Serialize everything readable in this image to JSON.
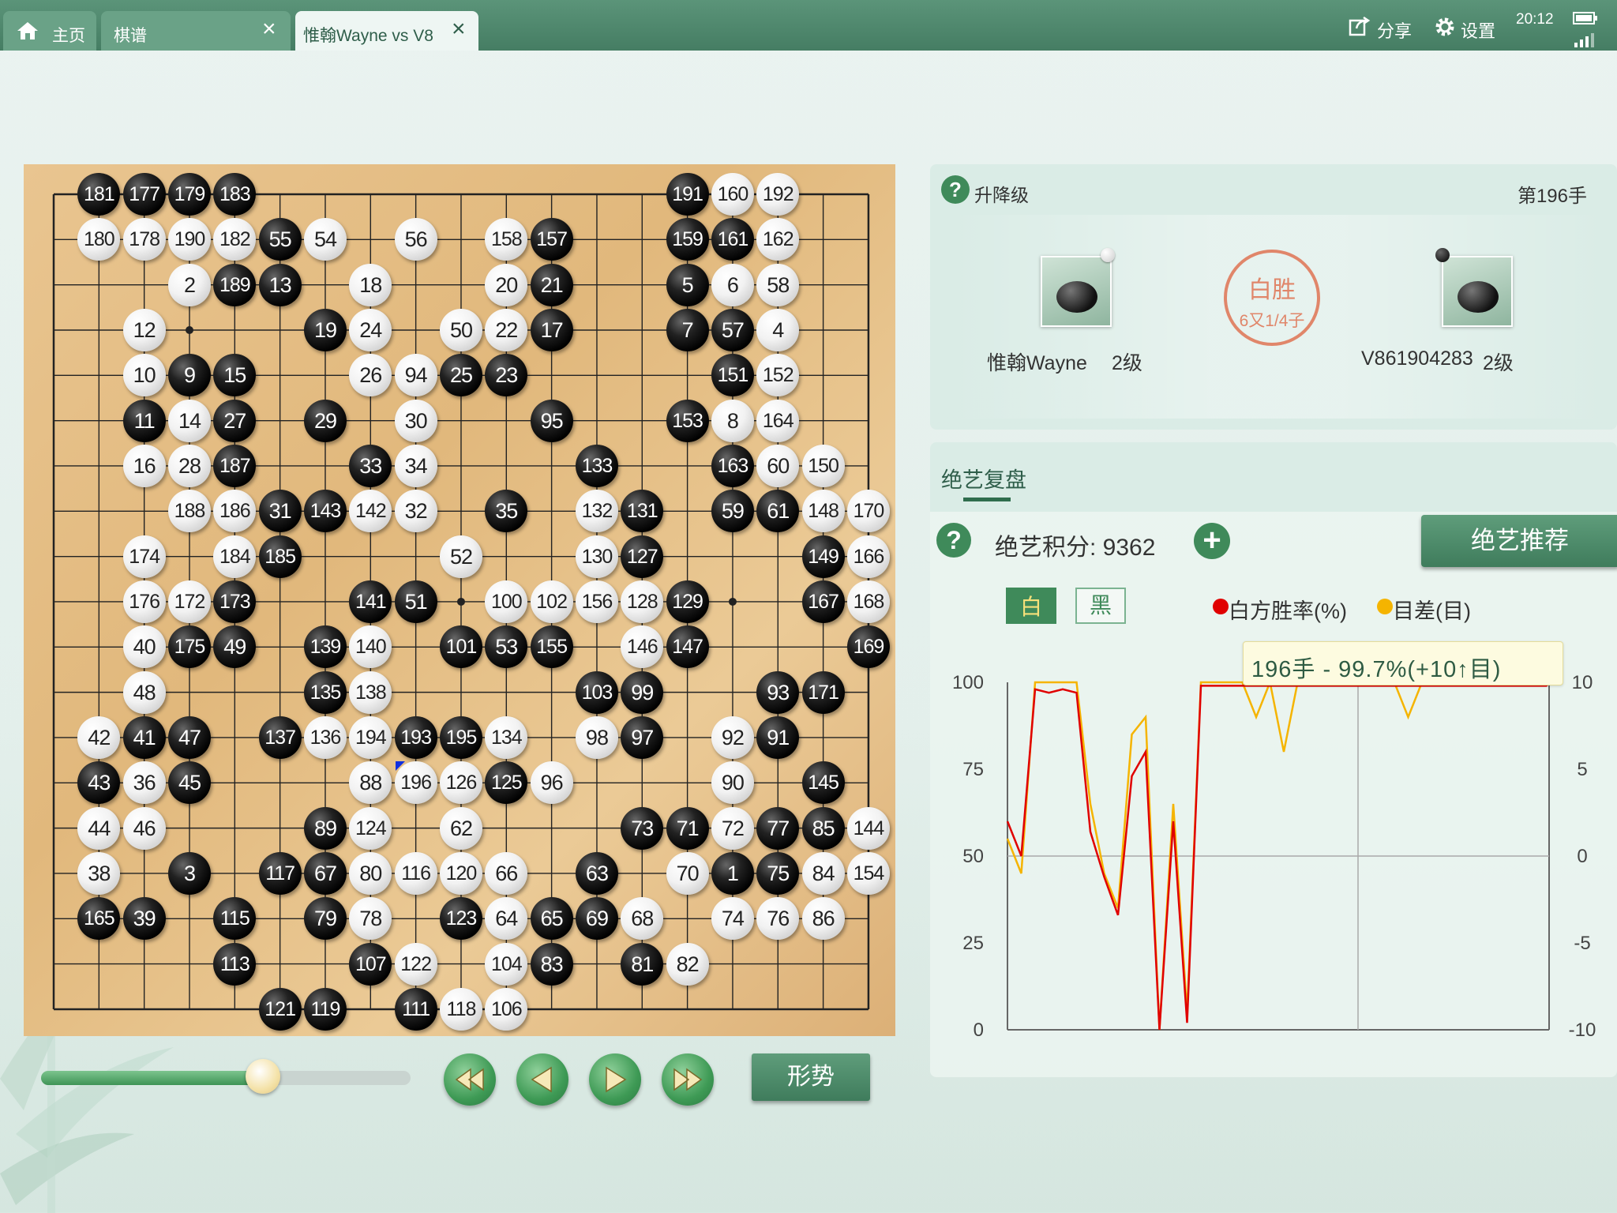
{
  "tabs": [
    {
      "label": "主页",
      "icon": "home-icon"
    },
    {
      "label": "棋谱",
      "close": "×"
    },
    {
      "label": "惟翰Wayne vs V8",
      "close": "×"
    }
  ],
  "toolbar": {
    "share": "分享",
    "settings": "设置",
    "time": "20:12",
    "icons": [
      "share-icon",
      "gear-icon",
      "battery-icon",
      "signal-icon"
    ]
  },
  "board": {
    "size": 19,
    "last_move": 196,
    "stones": [
      {
        "n": "181",
        "c": "b",
        "x": 1,
        "y": 0
      },
      {
        "n": "177",
        "c": "b",
        "x": 2,
        "y": 0
      },
      {
        "n": "179",
        "c": "b",
        "x": 3,
        "y": 0
      },
      {
        "n": "183",
        "c": "b",
        "x": 4,
        "y": 0
      },
      {
        "n": "191",
        "c": "b",
        "x": 14,
        "y": 0
      },
      {
        "n": "160",
        "c": "w",
        "x": 15,
        "y": 0
      },
      {
        "n": "192",
        "c": "w",
        "x": 16,
        "y": 0
      },
      {
        "n": "180",
        "c": "w",
        "x": 1,
        "y": 1
      },
      {
        "n": "178",
        "c": "w",
        "x": 2,
        "y": 1
      },
      {
        "n": "190",
        "c": "w",
        "x": 3,
        "y": 1
      },
      {
        "n": "182",
        "c": "w",
        "x": 4,
        "y": 1
      },
      {
        "n": "55",
        "c": "b",
        "x": 5,
        "y": 1
      },
      {
        "n": "54",
        "c": "w",
        "x": 6,
        "y": 1
      },
      {
        "n": "56",
        "c": "w",
        "x": 8,
        "y": 1
      },
      {
        "n": "158",
        "c": "w",
        "x": 10,
        "y": 1
      },
      {
        "n": "157",
        "c": "b",
        "x": 11,
        "y": 1
      },
      {
        "n": "159",
        "c": "b",
        "x": 14,
        "y": 1
      },
      {
        "n": "161",
        "c": "b",
        "x": 15,
        "y": 1
      },
      {
        "n": "162",
        "c": "w",
        "x": 16,
        "y": 1
      },
      {
        "n": "2",
        "c": "w",
        "x": 3,
        "y": 2
      },
      {
        "n": "189",
        "c": "b",
        "x": 4,
        "y": 2
      },
      {
        "n": "13",
        "c": "b",
        "x": 5,
        "y": 2
      },
      {
        "n": "18",
        "c": "w",
        "x": 7,
        "y": 2
      },
      {
        "n": "20",
        "c": "w",
        "x": 10,
        "y": 2
      },
      {
        "n": "21",
        "c": "b",
        "x": 11,
        "y": 2
      },
      {
        "n": "5",
        "c": "b",
        "x": 14,
        "y": 2
      },
      {
        "n": "6",
        "c": "w",
        "x": 15,
        "y": 2
      },
      {
        "n": "58",
        "c": "w",
        "x": 16,
        "y": 2
      },
      {
        "n": "12",
        "c": "w",
        "x": 2,
        "y": 3
      },
      {
        "n": "19",
        "c": "b",
        "x": 6,
        "y": 3
      },
      {
        "n": "24",
        "c": "w",
        "x": 7,
        "y": 3
      },
      {
        "n": "50",
        "c": "w",
        "x": 9,
        "y": 3
      },
      {
        "n": "22",
        "c": "w",
        "x": 10,
        "y": 3
      },
      {
        "n": "17",
        "c": "b",
        "x": 11,
        "y": 3
      },
      {
        "n": "7",
        "c": "b",
        "x": 14,
        "y": 3
      },
      {
        "n": "57",
        "c": "b",
        "x": 15,
        "y": 3
      },
      {
        "n": "4",
        "c": "w",
        "x": 16,
        "y": 3
      },
      {
        "n": "10",
        "c": "w",
        "x": 2,
        "y": 4
      },
      {
        "n": "9",
        "c": "b",
        "x": 3,
        "y": 4
      },
      {
        "n": "15",
        "c": "b",
        "x": 4,
        "y": 4
      },
      {
        "n": "26",
        "c": "w",
        "x": 7,
        "y": 4
      },
      {
        "n": "94",
        "c": "w",
        "x": 8,
        "y": 4
      },
      {
        "n": "25",
        "c": "b",
        "x": 9,
        "y": 4
      },
      {
        "n": "23",
        "c": "b",
        "x": 10,
        "y": 4
      },
      {
        "n": "151",
        "c": "b",
        "x": 15,
        "y": 4
      },
      {
        "n": "152",
        "c": "w",
        "x": 16,
        "y": 4
      },
      {
        "n": "11",
        "c": "b",
        "x": 2,
        "y": 5
      },
      {
        "n": "14",
        "c": "w",
        "x": 3,
        "y": 5
      },
      {
        "n": "27",
        "c": "b",
        "x": 4,
        "y": 5
      },
      {
        "n": "29",
        "c": "b",
        "x": 6,
        "y": 5
      },
      {
        "n": "30",
        "c": "w",
        "x": 8,
        "y": 5
      },
      {
        "n": "95",
        "c": "b",
        "x": 11,
        "y": 5
      },
      {
        "n": "153",
        "c": "b",
        "x": 14,
        "y": 5
      },
      {
        "n": "8",
        "c": "w",
        "x": 15,
        "y": 5
      },
      {
        "n": "164",
        "c": "w",
        "x": 16,
        "y": 5
      },
      {
        "n": "16",
        "c": "w",
        "x": 2,
        "y": 6
      },
      {
        "n": "28",
        "c": "w",
        "x": 3,
        "y": 6
      },
      {
        "n": "187",
        "c": "b",
        "x": 4,
        "y": 6
      },
      {
        "n": "33",
        "c": "b",
        "x": 7,
        "y": 6
      },
      {
        "n": "34",
        "c": "w",
        "x": 8,
        "y": 6
      },
      {
        "n": "133",
        "c": "b",
        "x": 12,
        "y": 6
      },
      {
        "n": "163",
        "c": "b",
        "x": 15,
        "y": 6
      },
      {
        "n": "60",
        "c": "w",
        "x": 16,
        "y": 6
      },
      {
        "n": "150",
        "c": "w",
        "x": 17,
        "y": 6
      },
      {
        "n": "188",
        "c": "w",
        "x": 3,
        "y": 7
      },
      {
        "n": "186",
        "c": "w",
        "x": 4,
        "y": 7
      },
      {
        "n": "31",
        "c": "b",
        "x": 5,
        "y": 7
      },
      {
        "n": "143",
        "c": "b",
        "x": 6,
        "y": 7
      },
      {
        "n": "142",
        "c": "w",
        "x": 7,
        "y": 7
      },
      {
        "n": "32",
        "c": "w",
        "x": 8,
        "y": 7
      },
      {
        "n": "35",
        "c": "b",
        "x": 10,
        "y": 7
      },
      {
        "n": "132",
        "c": "w",
        "x": 12,
        "y": 7
      },
      {
        "n": "131",
        "c": "b",
        "x": 13,
        "y": 7
      },
      {
        "n": "59",
        "c": "b",
        "x": 15,
        "y": 7
      },
      {
        "n": "61",
        "c": "b",
        "x": 16,
        "y": 7
      },
      {
        "n": "148",
        "c": "w",
        "x": 17,
        "y": 7
      },
      {
        "n": "170",
        "c": "w",
        "x": 18,
        "y": 7
      },
      {
        "n": "174",
        "c": "w",
        "x": 2,
        "y": 8
      },
      {
        "n": "184",
        "c": "w",
        "x": 4,
        "y": 8
      },
      {
        "n": "185",
        "c": "b",
        "x": 5,
        "y": 8
      },
      {
        "n": "52",
        "c": "w",
        "x": 9,
        "y": 8
      },
      {
        "n": "130",
        "c": "w",
        "x": 12,
        "y": 8
      },
      {
        "n": "127",
        "c": "b",
        "x": 13,
        "y": 8
      },
      {
        "n": "149",
        "c": "b",
        "x": 17,
        "y": 8
      },
      {
        "n": "166",
        "c": "w",
        "x": 18,
        "y": 8
      },
      {
        "n": "176",
        "c": "w",
        "x": 2,
        "y": 9
      },
      {
        "n": "172",
        "c": "w",
        "x": 3,
        "y": 9
      },
      {
        "n": "173",
        "c": "b",
        "x": 4,
        "y": 9
      },
      {
        "n": "141",
        "c": "b",
        "x": 7,
        "y": 9
      },
      {
        "n": "51",
        "c": "b",
        "x": 8,
        "y": 9
      },
      {
        "n": "100",
        "c": "w",
        "x": 10,
        "y": 9
      },
      {
        "n": "102",
        "c": "w",
        "x": 11,
        "y": 9
      },
      {
        "n": "156",
        "c": "w",
        "x": 12,
        "y": 9
      },
      {
        "n": "128",
        "c": "w",
        "x": 13,
        "y": 9
      },
      {
        "n": "129",
        "c": "b",
        "x": 14,
        "y": 9
      },
      {
        "n": "167",
        "c": "b",
        "x": 17,
        "y": 9
      },
      {
        "n": "168",
        "c": "w",
        "x": 18,
        "y": 9
      },
      {
        "n": "40",
        "c": "w",
        "x": 2,
        "y": 10
      },
      {
        "n": "175",
        "c": "b",
        "x": 3,
        "y": 10
      },
      {
        "n": "49",
        "c": "b",
        "x": 4,
        "y": 10
      },
      {
        "n": "139",
        "c": "b",
        "x": 6,
        "y": 10
      },
      {
        "n": "140",
        "c": "w",
        "x": 7,
        "y": 10
      },
      {
        "n": "101",
        "c": "b",
        "x": 9,
        "y": 10
      },
      {
        "n": "53",
        "c": "b",
        "x": 10,
        "y": 10
      },
      {
        "n": "155",
        "c": "b",
        "x": 11,
        "y": 10
      },
      {
        "n": "146",
        "c": "w",
        "x": 13,
        "y": 10
      },
      {
        "n": "147",
        "c": "b",
        "x": 14,
        "y": 10
      },
      {
        "n": "169",
        "c": "b",
        "x": 18,
        "y": 10
      },
      {
        "n": "48",
        "c": "w",
        "x": 2,
        "y": 11
      },
      {
        "n": "135",
        "c": "b",
        "x": 6,
        "y": 11
      },
      {
        "n": "138",
        "c": "w",
        "x": 7,
        "y": 11
      },
      {
        "n": "103",
        "c": "b",
        "x": 12,
        "y": 11
      },
      {
        "n": "99",
        "c": "b",
        "x": 13,
        "y": 11
      },
      {
        "n": "93",
        "c": "b",
        "x": 16,
        "y": 11
      },
      {
        "n": "171",
        "c": "b",
        "x": 17,
        "y": 11
      },
      {
        "n": "42",
        "c": "w",
        "x": 1,
        "y": 12
      },
      {
        "n": "41",
        "c": "b",
        "x": 2,
        "y": 12
      },
      {
        "n": "47",
        "c": "b",
        "x": 3,
        "y": 12
      },
      {
        "n": "137",
        "c": "b",
        "x": 5,
        "y": 12
      },
      {
        "n": "136",
        "c": "w",
        "x": 6,
        "y": 12
      },
      {
        "n": "194",
        "c": "w",
        "x": 7,
        "y": 12
      },
      {
        "n": "193",
        "c": "b",
        "x": 8,
        "y": 12
      },
      {
        "n": "195",
        "c": "b",
        "x": 9,
        "y": 12
      },
      {
        "n": "134",
        "c": "w",
        "x": 10,
        "y": 12
      },
      {
        "n": "98",
        "c": "w",
        "x": 12,
        "y": 12
      },
      {
        "n": "97",
        "c": "b",
        "x": 13,
        "y": 12
      },
      {
        "n": "92",
        "c": "w",
        "x": 15,
        "y": 12
      },
      {
        "n": "91",
        "c": "b",
        "x": 16,
        "y": 12
      },
      {
        "n": "43",
        "c": "b",
        "x": 1,
        "y": 13
      },
      {
        "n": "36",
        "c": "w",
        "x": 2,
        "y": 13
      },
      {
        "n": "45",
        "c": "b",
        "x": 3,
        "y": 13
      },
      {
        "n": "88",
        "c": "w",
        "x": 7,
        "y": 13
      },
      {
        "n": "196",
        "c": "w",
        "x": 8,
        "y": 13
      },
      {
        "n": "126",
        "c": "w",
        "x": 9,
        "y": 13
      },
      {
        "n": "125",
        "c": "b",
        "x": 10,
        "y": 13
      },
      {
        "n": "96",
        "c": "w",
        "x": 11,
        "y": 13
      },
      {
        "n": "90",
        "c": "w",
        "x": 15,
        "y": 13
      },
      {
        "n": "145",
        "c": "b",
        "x": 17,
        "y": 13
      },
      {
        "n": "44",
        "c": "w",
        "x": 1,
        "y": 14
      },
      {
        "n": "46",
        "c": "w",
        "x": 2,
        "y": 14
      },
      {
        "n": "89",
        "c": "b",
        "x": 6,
        "y": 14
      },
      {
        "n": "124",
        "c": "w",
        "x": 7,
        "y": 14
      },
      {
        "n": "62",
        "c": "w",
        "x": 9,
        "y": 14
      },
      {
        "n": "73",
        "c": "b",
        "x": 13,
        "y": 14
      },
      {
        "n": "71",
        "c": "b",
        "x": 14,
        "y": 14
      },
      {
        "n": "72",
        "c": "w",
        "x": 15,
        "y": 14
      },
      {
        "n": "77",
        "c": "b",
        "x": 16,
        "y": 14
      },
      {
        "n": "85",
        "c": "b",
        "x": 17,
        "y": 14
      },
      {
        "n": "144",
        "c": "w",
        "x": 18,
        "y": 14
      },
      {
        "n": "38",
        "c": "w",
        "x": 1,
        "y": 15
      },
      {
        "n": "3",
        "c": "b",
        "x": 3,
        "y": 15
      },
      {
        "n": "117",
        "c": "b",
        "x": 5,
        "y": 15
      },
      {
        "n": "67",
        "c": "b",
        "x": 6,
        "y": 15
      },
      {
        "n": "80",
        "c": "w",
        "x": 7,
        "y": 15
      },
      {
        "n": "116",
        "c": "w",
        "x": 8,
        "y": 15
      },
      {
        "n": "120",
        "c": "w",
        "x": 9,
        "y": 15
      },
      {
        "n": "66",
        "c": "w",
        "x": 10,
        "y": 15
      },
      {
        "n": "63",
        "c": "b",
        "x": 12,
        "y": 15
      },
      {
        "n": "70",
        "c": "w",
        "x": 14,
        "y": 15
      },
      {
        "n": "1",
        "c": "b",
        "x": 15,
        "y": 15
      },
      {
        "n": "75",
        "c": "b",
        "x": 16,
        "y": 15
      },
      {
        "n": "84",
        "c": "w",
        "x": 17,
        "y": 15
      },
      {
        "n": "154",
        "c": "w",
        "x": 18,
        "y": 15
      },
      {
        "n": "165",
        "c": "b",
        "x": 1,
        "y": 16
      },
      {
        "n": "39",
        "c": "b",
        "x": 2,
        "y": 16
      },
      {
        "n": "115",
        "c": "b",
        "x": 4,
        "y": 16
      },
      {
        "n": "79",
        "c": "b",
        "x": 6,
        "y": 16
      },
      {
        "n": "78",
        "c": "w",
        "x": 7,
        "y": 16
      },
      {
        "n": "123",
        "c": "b",
        "x": 9,
        "y": 16
      },
      {
        "n": "64",
        "c": "w",
        "x": 10,
        "y": 16
      },
      {
        "n": "65",
        "c": "b",
        "x": 11,
        "y": 16
      },
      {
        "n": "69",
        "c": "b",
        "x": 12,
        "y": 16
      },
      {
        "n": "68",
        "c": "w",
        "x": 13,
        "y": 16
      },
      {
        "n": "74",
        "c": "w",
        "x": 15,
        "y": 16
      },
      {
        "n": "76",
        "c": "w",
        "x": 16,
        "y": 16
      },
      {
        "n": "86",
        "c": "w",
        "x": 17,
        "y": 16
      },
      {
        "n": "113",
        "c": "b",
        "x": 4,
        "y": 17
      },
      {
        "n": "107",
        "c": "b",
        "x": 7,
        "y": 17
      },
      {
        "n": "122",
        "c": "w",
        "x": 8,
        "y": 17
      },
      {
        "n": "104",
        "c": "w",
        "x": 10,
        "y": 17
      },
      {
        "n": "83",
        "c": "b",
        "x": 11,
        "y": 17
      },
      {
        "n": "81",
        "c": "b",
        "x": 13,
        "y": 17
      },
      {
        "n": "82",
        "c": "w",
        "x": 14,
        "y": 17
      },
      {
        "n": "121",
        "c": "b",
        "x": 5,
        "y": 18
      },
      {
        "n": "119",
        "c": "b",
        "x": 6,
        "y": 18
      },
      {
        "n": "111",
        "c": "b",
        "x": 8,
        "y": 18
      },
      {
        "n": "118",
        "c": "w",
        "x": 9,
        "y": 18
      },
      {
        "n": "106",
        "c": "w",
        "x": 10,
        "y": 18
      }
    ]
  },
  "controls": {
    "slider": 0.6,
    "buttons": [
      "first-move-icon",
      "prev-move-icon",
      "next-move-icon",
      "last-move-icon"
    ],
    "shape_label": "形势"
  },
  "game": {
    "help_label": "升降级",
    "move_label": "第196手",
    "black_player": "惟翰Wayne",
    "black_rank": "2级",
    "white_player": "V861904283",
    "white_rank": "2级",
    "result_title": "白胜",
    "result_detail": "6又1/4子"
  },
  "review": {
    "tab_label": "绝艺复盘",
    "score_label": "绝艺积分: 9362",
    "recommend_label": "绝艺推荐",
    "toggle_white": "白",
    "toggle_black": "黑",
    "legend_winrate": "白方胜率(%)",
    "legend_diff": "目差(目)",
    "tooltip": "196手 - 99.7%(+10↑目)",
    "colors": {
      "winrate": "#e00000",
      "diff": "#f5b400",
      "accent": "#3f7c5c"
    }
  },
  "chart_data": {
    "type": "line",
    "title": "",
    "xlabel": "",
    "ylabel": "",
    "y2label": "",
    "ylim": [
      0,
      100
    ],
    "y2lim": [
      -10,
      10
    ],
    "yticks": [
      "100",
      "75",
      "50",
      "25",
      "0"
    ],
    "y2ticks": [
      "10",
      "5",
      "0",
      "-5",
      "-10"
    ],
    "x": [
      0,
      5,
      10,
      15,
      20,
      25,
      30,
      35,
      40,
      45,
      50,
      55,
      60,
      65,
      70,
      75,
      80,
      85,
      90,
      95,
      100,
      105,
      110,
      115,
      120,
      125,
      130,
      135,
      140,
      145,
      150,
      155,
      160,
      165,
      170,
      175,
      180,
      185,
      190,
      195,
      196
    ],
    "series": [
      {
        "name": "白方胜率(%)",
        "values": [
          60,
          50,
          98,
          97,
          98,
          97,
          57,
          44,
          33,
          73,
          80,
          0,
          60,
          2,
          99,
          99,
          99,
          99,
          99,
          99,
          99,
          99,
          99,
          99,
          99,
          99,
          99,
          99,
          99,
          99,
          99,
          99,
          99,
          99,
          99,
          99,
          99,
          99,
          99,
          99,
          99.7
        ]
      },
      {
        "name": "目差(目)",
        "values": [
          1,
          -1,
          10,
          10,
          10,
          10,
          3,
          -1,
          -3,
          7,
          8,
          -10,
          3,
          -9,
          10,
          10,
          10,
          10,
          8,
          10,
          6,
          10,
          10,
          10,
          10,
          10,
          10,
          10,
          10,
          8,
          10,
          10,
          10,
          10,
          10,
          10,
          10,
          10,
          10,
          10,
          10
        ]
      }
    ]
  }
}
